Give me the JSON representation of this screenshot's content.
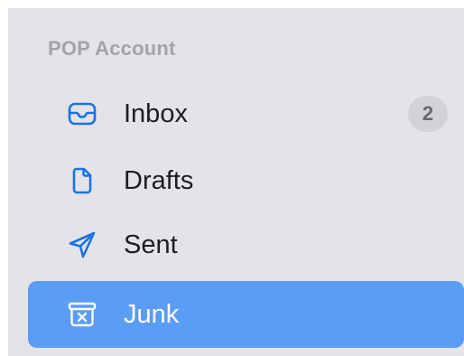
{
  "sidebar": {
    "section_title": "POP Account",
    "items": [
      {
        "label": "Inbox",
        "icon": "tray-icon",
        "badge": "2"
      },
      {
        "label": "Drafts",
        "icon": "document-icon"
      },
      {
        "label": "Sent",
        "icon": "paper-plane-icon"
      },
      {
        "label": "Junk",
        "icon": "junk-box-icon",
        "selected": true
      }
    ]
  },
  "colors": {
    "sidebar_bg": "#e4e3e8",
    "accent_icon": "#1a73e8",
    "selected_bg": "#5b9cf4",
    "section_header": "#a4a3a9",
    "badge_bg": "#d3d2d7"
  }
}
